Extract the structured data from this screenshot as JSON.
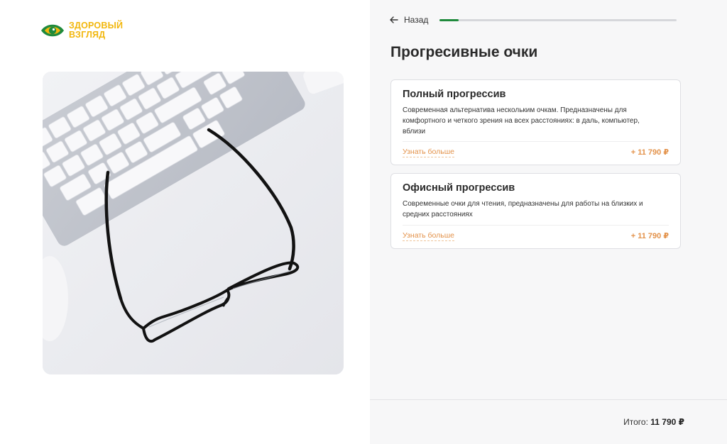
{
  "brand": {
    "line1": "ЗДОРОВЫЙ",
    "line2": "ВЗГЛЯД",
    "colors": {
      "yellow": "#f2b70d",
      "green": "#1f8a3c",
      "orange": "#e3924a"
    }
  },
  "hero_image": {
    "icon": "glasses-on-keyboard-photo"
  },
  "nav": {
    "back_label": "Назад",
    "back_icon": "arrow-left-icon"
  },
  "progress": {
    "value_fraction": 0.08
  },
  "page": {
    "title": "Прогресивные очки"
  },
  "options": [
    {
      "title": "Полный прогрессив",
      "description": "Современная альтернатива нескольким очкам. Предназначены для комфортного и четкого зрения на всех расстояниях: в даль, компьютер, вблизи",
      "link_label": "Узнать больше",
      "price": "+ 11 790 ₽"
    },
    {
      "title": "Офисный прогрессив",
      "description": "Современные очки для чтения, предназначены для работы на близких и средних расстояниях",
      "link_label": "Узнать больше",
      "price": "+ 11 790 ₽"
    }
  ],
  "footer": {
    "total_label": "Итого:",
    "total_value": "11 790 ₽"
  }
}
